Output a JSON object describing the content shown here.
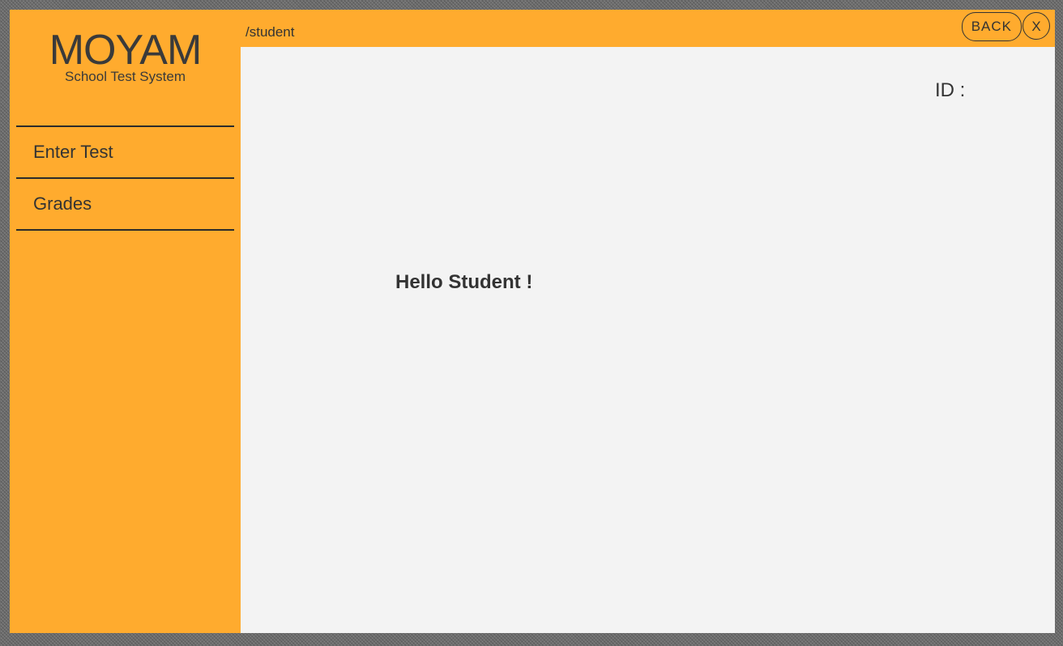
{
  "brand": {
    "title": "MOYAM",
    "subtitle": "School Test System"
  },
  "sidebar": {
    "items": [
      {
        "label": "Enter Test"
      },
      {
        "label": "Grades"
      }
    ]
  },
  "header": {
    "route": "/student",
    "back_label": "BACK",
    "close_label": "X"
  },
  "main": {
    "id_label": "ID :",
    "greeting": "Hello Student !"
  },
  "colors": {
    "accent": "#ffab2e",
    "content_bg": "#f3f3f3",
    "text": "#333333"
  },
  "icons": {
    "close": "close-icon"
  }
}
